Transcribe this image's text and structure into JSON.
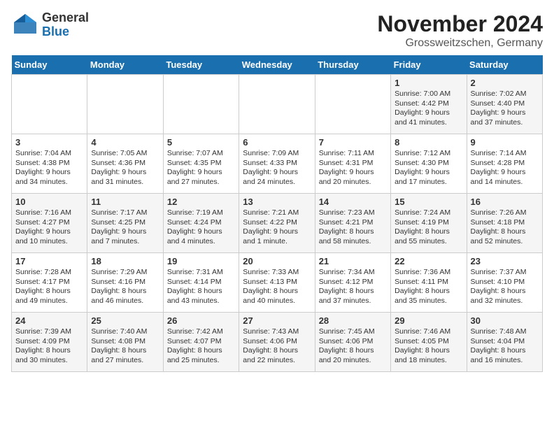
{
  "logo": {
    "general": "General",
    "blue": "Blue"
  },
  "title": "November 2024",
  "subtitle": "Grossweitzschen, Germany",
  "days_of_week": [
    "Sunday",
    "Monday",
    "Tuesday",
    "Wednesday",
    "Thursday",
    "Friday",
    "Saturday"
  ],
  "weeks": [
    [
      {
        "day": "",
        "info": ""
      },
      {
        "day": "",
        "info": ""
      },
      {
        "day": "",
        "info": ""
      },
      {
        "day": "",
        "info": ""
      },
      {
        "day": "",
        "info": ""
      },
      {
        "day": "1",
        "info": "Sunrise: 7:00 AM\nSunset: 4:42 PM\nDaylight: 9 hours and 41 minutes."
      },
      {
        "day": "2",
        "info": "Sunrise: 7:02 AM\nSunset: 4:40 PM\nDaylight: 9 hours and 37 minutes."
      }
    ],
    [
      {
        "day": "3",
        "info": "Sunrise: 7:04 AM\nSunset: 4:38 PM\nDaylight: 9 hours and 34 minutes."
      },
      {
        "day": "4",
        "info": "Sunrise: 7:05 AM\nSunset: 4:36 PM\nDaylight: 9 hours and 31 minutes."
      },
      {
        "day": "5",
        "info": "Sunrise: 7:07 AM\nSunset: 4:35 PM\nDaylight: 9 hours and 27 minutes."
      },
      {
        "day": "6",
        "info": "Sunrise: 7:09 AM\nSunset: 4:33 PM\nDaylight: 9 hours and 24 minutes."
      },
      {
        "day": "7",
        "info": "Sunrise: 7:11 AM\nSunset: 4:31 PM\nDaylight: 9 hours and 20 minutes."
      },
      {
        "day": "8",
        "info": "Sunrise: 7:12 AM\nSunset: 4:30 PM\nDaylight: 9 hours and 17 minutes."
      },
      {
        "day": "9",
        "info": "Sunrise: 7:14 AM\nSunset: 4:28 PM\nDaylight: 9 hours and 14 minutes."
      }
    ],
    [
      {
        "day": "10",
        "info": "Sunrise: 7:16 AM\nSunset: 4:27 PM\nDaylight: 9 hours and 10 minutes."
      },
      {
        "day": "11",
        "info": "Sunrise: 7:17 AM\nSunset: 4:25 PM\nDaylight: 9 hours and 7 minutes."
      },
      {
        "day": "12",
        "info": "Sunrise: 7:19 AM\nSunset: 4:24 PM\nDaylight: 9 hours and 4 minutes."
      },
      {
        "day": "13",
        "info": "Sunrise: 7:21 AM\nSunset: 4:22 PM\nDaylight: 9 hours and 1 minute."
      },
      {
        "day": "14",
        "info": "Sunrise: 7:23 AM\nSunset: 4:21 PM\nDaylight: 8 hours and 58 minutes."
      },
      {
        "day": "15",
        "info": "Sunrise: 7:24 AM\nSunset: 4:19 PM\nDaylight: 8 hours and 55 minutes."
      },
      {
        "day": "16",
        "info": "Sunrise: 7:26 AM\nSunset: 4:18 PM\nDaylight: 8 hours and 52 minutes."
      }
    ],
    [
      {
        "day": "17",
        "info": "Sunrise: 7:28 AM\nSunset: 4:17 PM\nDaylight: 8 hours and 49 minutes."
      },
      {
        "day": "18",
        "info": "Sunrise: 7:29 AM\nSunset: 4:16 PM\nDaylight: 8 hours and 46 minutes."
      },
      {
        "day": "19",
        "info": "Sunrise: 7:31 AM\nSunset: 4:14 PM\nDaylight: 8 hours and 43 minutes."
      },
      {
        "day": "20",
        "info": "Sunrise: 7:33 AM\nSunset: 4:13 PM\nDaylight: 8 hours and 40 minutes."
      },
      {
        "day": "21",
        "info": "Sunrise: 7:34 AM\nSunset: 4:12 PM\nDaylight: 8 hours and 37 minutes."
      },
      {
        "day": "22",
        "info": "Sunrise: 7:36 AM\nSunset: 4:11 PM\nDaylight: 8 hours and 35 minutes."
      },
      {
        "day": "23",
        "info": "Sunrise: 7:37 AM\nSunset: 4:10 PM\nDaylight: 8 hours and 32 minutes."
      }
    ],
    [
      {
        "day": "24",
        "info": "Sunrise: 7:39 AM\nSunset: 4:09 PM\nDaylight: 8 hours and 30 minutes."
      },
      {
        "day": "25",
        "info": "Sunrise: 7:40 AM\nSunset: 4:08 PM\nDaylight: 8 hours and 27 minutes."
      },
      {
        "day": "26",
        "info": "Sunrise: 7:42 AM\nSunset: 4:07 PM\nDaylight: 8 hours and 25 minutes."
      },
      {
        "day": "27",
        "info": "Sunrise: 7:43 AM\nSunset: 4:06 PM\nDaylight: 8 hours and 22 minutes."
      },
      {
        "day": "28",
        "info": "Sunrise: 7:45 AM\nSunset: 4:06 PM\nDaylight: 8 hours and 20 minutes."
      },
      {
        "day": "29",
        "info": "Sunrise: 7:46 AM\nSunset: 4:05 PM\nDaylight: 8 hours and 18 minutes."
      },
      {
        "day": "30",
        "info": "Sunrise: 7:48 AM\nSunset: 4:04 PM\nDaylight: 8 hours and 16 minutes."
      }
    ]
  ]
}
